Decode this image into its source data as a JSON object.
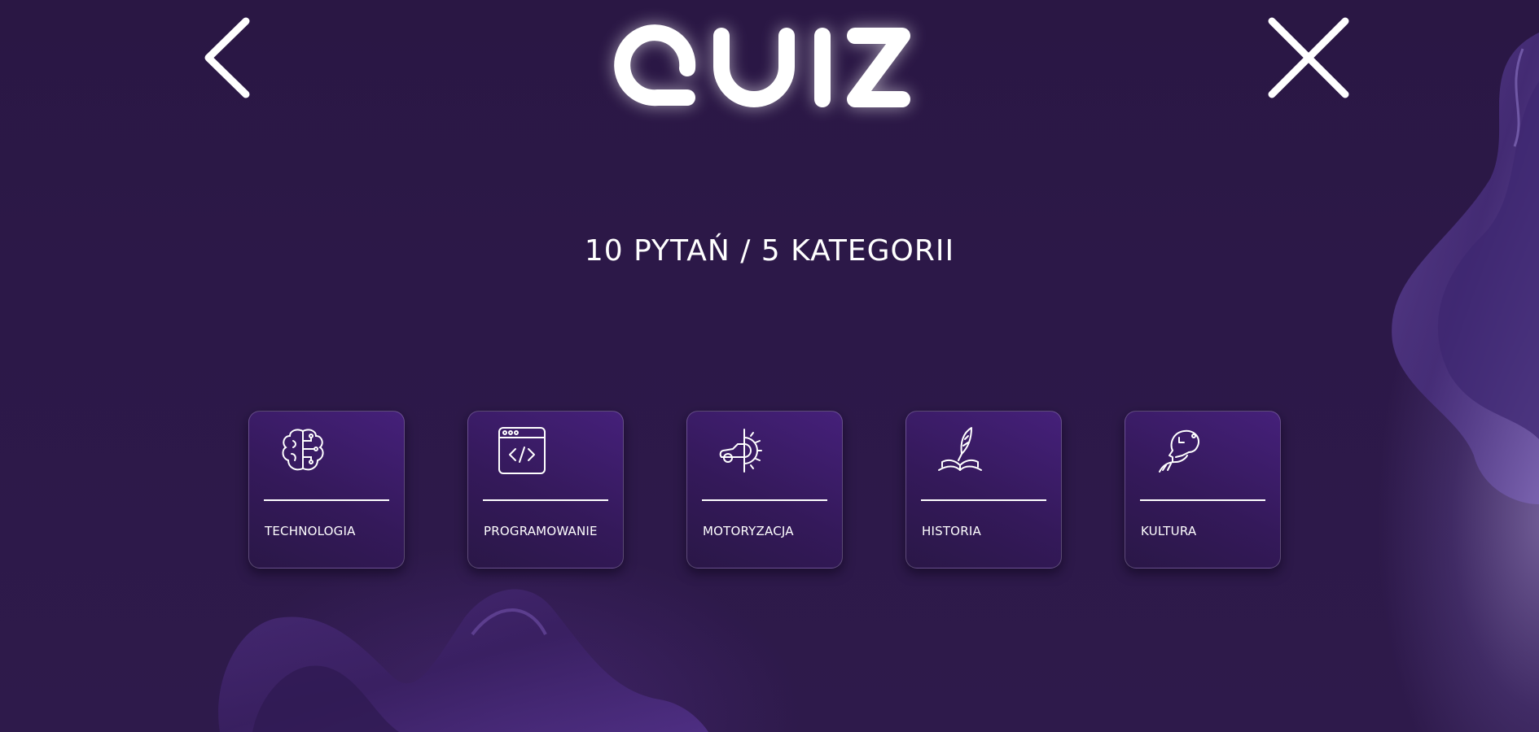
{
  "header": {
    "logo_text": "QUIZ",
    "back_icon": "chevron-left-icon",
    "close_icon": "close-icon"
  },
  "subtitle": "10 PYTAŃ / 5 KATEGORII",
  "categories": [
    {
      "label": "TECHNOLOGIA",
      "icon": "brain-circuit-icon"
    },
    {
      "label": "PROGRAMOWANIE",
      "icon": "code-window-icon"
    },
    {
      "label": "MOTORYZACJA",
      "icon": "car-gear-icon"
    },
    {
      "label": "HISTORIA",
      "icon": "quill-book-icon"
    },
    {
      "label": "KULTURA",
      "icon": "thinker-head-icon"
    }
  ],
  "colors": {
    "background": "#2c1848",
    "card_gradient_start": "#2a1747",
    "card_gradient_end": "#45207a",
    "text": "#ffffff"
  }
}
